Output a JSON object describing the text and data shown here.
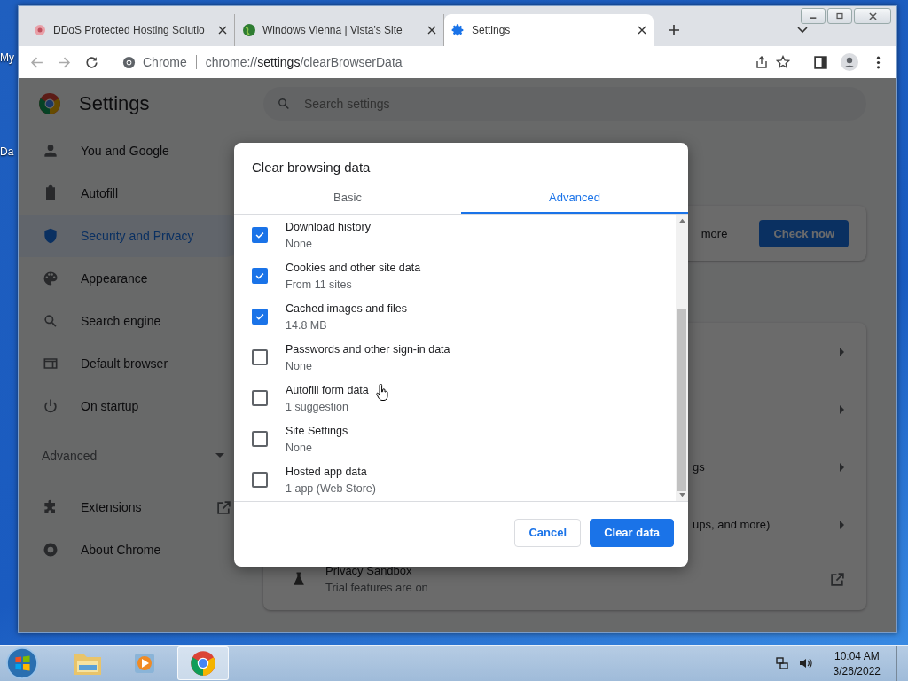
{
  "desktop": {
    "icons": [
      {
        "label": "My"
      },
      {
        "label": "Da"
      }
    ]
  },
  "browser": {
    "tabs": [
      {
        "title": "DDoS Protected Hosting Solutio",
        "selected": false
      },
      {
        "title": "Windows Vienna | Vista's Site",
        "selected": false
      },
      {
        "title": "Settings",
        "selected": true
      }
    ],
    "address": {
      "site": "Chrome",
      "url_prefix": "chrome://",
      "url_host": "settings",
      "url_path": "/clearBrowserData"
    }
  },
  "settings": {
    "title": "Settings",
    "search": {
      "placeholder": "Search settings"
    },
    "nav": [
      {
        "label": "You and Google",
        "selected": false
      },
      {
        "label": "Autofill",
        "selected": false
      },
      {
        "label": "Security and Privacy",
        "selected": true
      },
      {
        "label": "Appearance",
        "selected": false
      },
      {
        "label": "Search engine",
        "selected": false
      },
      {
        "label": "Default browser",
        "selected": false
      },
      {
        "label": "On startup",
        "selected": false
      }
    ],
    "advanced": "Advanced",
    "nav_bottom": [
      {
        "label": "Extensions",
        "external": true
      },
      {
        "label": "About Chrome",
        "external": false
      }
    ],
    "safety_card": {
      "text": "more",
      "button": "Check now"
    },
    "rows": [
      {
        "kind": "plain"
      },
      {
        "kind": "plain"
      },
      {
        "kind": "text",
        "text": "gs"
      },
      {
        "kind": "text",
        "text": "ups, and more)"
      }
    ],
    "sandbox": {
      "title": "Privacy Sandbox",
      "subtitle": "Trial features are on"
    }
  },
  "dialog": {
    "title": "Clear browsing data",
    "tabs": [
      {
        "label": "Basic",
        "selected": false
      },
      {
        "label": "Advanced",
        "selected": true
      }
    ],
    "items": [
      {
        "label": "Download history",
        "detail": "None",
        "checked": true
      },
      {
        "label": "Cookies and other site data",
        "detail": "From 11 sites",
        "checked": true
      },
      {
        "label": "Cached images and files",
        "detail": "14.8 MB",
        "checked": true
      },
      {
        "label": "Passwords and other sign-in data",
        "detail": "None",
        "checked": false
      },
      {
        "label": "Autofill form data",
        "detail": "1 suggestion",
        "checked": false
      },
      {
        "label": "Site Settings",
        "detail": "None",
        "checked": false
      },
      {
        "label": "Hosted app data",
        "detail": "1 app (Web Store)",
        "checked": false
      }
    ],
    "buttons": [
      {
        "label": "Cancel",
        "kind": "secondary"
      },
      {
        "label": "Clear data",
        "kind": "primary"
      }
    ]
  },
  "taskbar": {
    "apps": [
      {
        "selected": false
      },
      {
        "selected": false
      },
      {
        "selected": true
      }
    ],
    "time": "10:04 AM",
    "date": "3/26/2022"
  }
}
